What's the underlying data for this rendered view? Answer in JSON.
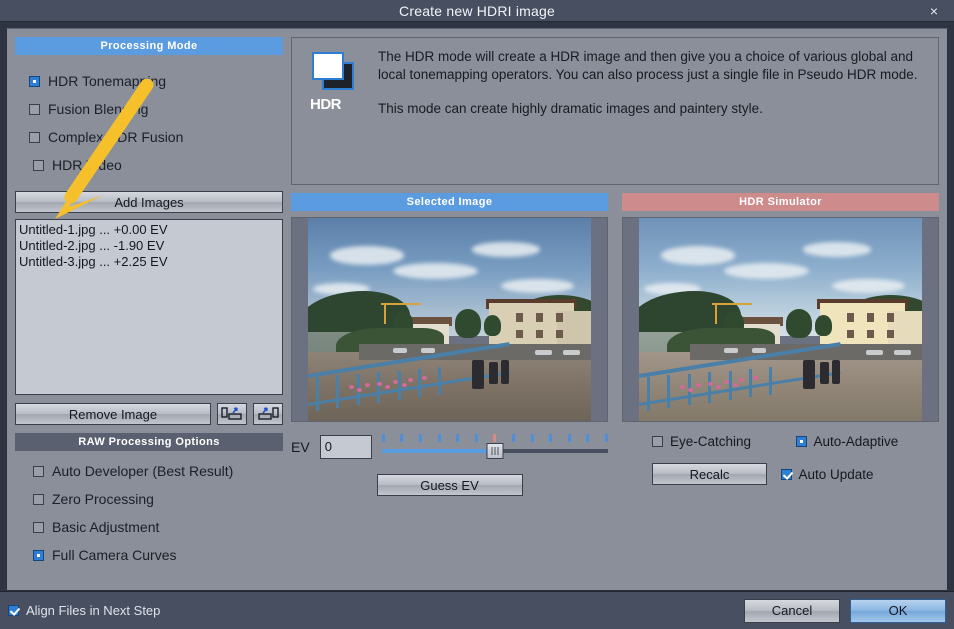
{
  "window": {
    "title": "Create new HDRI image",
    "close_label": "×"
  },
  "processing_mode": {
    "header": "Processing  Mode",
    "options": [
      {
        "label": "HDR Tonemapping",
        "selected": true
      },
      {
        "label": "Fusion Blending",
        "selected": false
      },
      {
        "label": "Complex HDR Fusion",
        "selected": false
      },
      {
        "label": "HDR Video",
        "selected": false
      }
    ]
  },
  "images": {
    "add_button": "Add Images",
    "remove_button": "Remove Image",
    "move_up_icon": "move-up-icon",
    "move_down_icon": "move-down-icon",
    "files": [
      "Untitled-1.jpg ... +0.00 EV",
      "Untitled-2.jpg ... -1.90 EV",
      "Untitled-3.jpg ... +2.25 EV"
    ]
  },
  "raw_options": {
    "header": "RAW Processing Options",
    "options": [
      {
        "label": "Auto Developer (Best Result)",
        "selected": false
      },
      {
        "label": "Zero Processing",
        "selected": false
      },
      {
        "label": "Basic Adjustment",
        "selected": false
      },
      {
        "label": "Full Camera Curves",
        "selected": true
      }
    ]
  },
  "description": {
    "icon": "hdr-icon",
    "icon_text": "HDR",
    "paragraph1": "The HDR mode will create a HDR image and then give you a choice of various global and local tonemapping operators. You can also process just a single file in Pseudo HDR mode.",
    "paragraph2": "This mode can create highly dramatic images and paintery style."
  },
  "previews": {
    "selected": {
      "header": "Selected Image"
    },
    "simulator": {
      "header": "HDR Simulator"
    }
  },
  "ev_controls": {
    "label": "EV",
    "value": "0",
    "placeholder": "",
    "guess_button": "Guess EV",
    "tick_count": 13,
    "mid_tick_index": 6,
    "slider_position_pct": 50
  },
  "simulator_controls": {
    "eye_catching": {
      "label": "Eye-Catching",
      "checked": false
    },
    "auto_adaptive": {
      "label": "Auto-Adaptive",
      "selected": true
    },
    "recalc_button": "Recalc",
    "auto_update": {
      "label": "Auto Update",
      "checked": true
    }
  },
  "footer": {
    "align_files": {
      "label": "Align Files in Next Step",
      "checked": true
    },
    "cancel_button": "Cancel",
    "ok_button": "OK"
  },
  "colors": {
    "accent_blue": "#5b9bdf",
    "accent_salmon": "#cd8b8b",
    "panel_gray": "#8b8f99",
    "chrome_dark": "#474f61",
    "annotation_yellow": "#f5c02a"
  }
}
